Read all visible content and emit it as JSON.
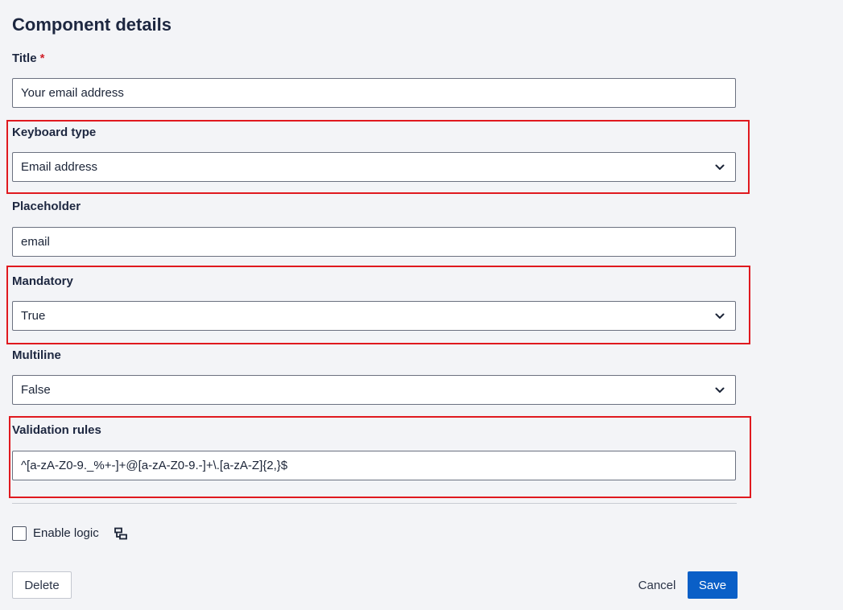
{
  "panel": {
    "title": "Component details"
  },
  "fields": {
    "title": {
      "label": "Title",
      "required_marker": "*",
      "value": "Your email address"
    },
    "keyboard_type": {
      "label": "Keyboard type",
      "value": "Email address"
    },
    "placeholder": {
      "label": "Placeholder",
      "value": "email"
    },
    "mandatory": {
      "label": "Mandatory",
      "value": "True"
    },
    "multiline": {
      "label": "Multiline",
      "value": "False"
    },
    "validation_rules": {
      "label": "Validation rules",
      "value": "^[a-zA-Z0-9._%+-]+@[a-zA-Z0-9.-]+\\.[a-zA-Z]{2,}$"
    }
  },
  "logic": {
    "label": "Enable logic",
    "checked": false,
    "icon": "logic-flow-icon"
  },
  "actions": {
    "delete_label": "Delete",
    "cancel_label": "Cancel",
    "save_label": "Save"
  },
  "colors": {
    "highlight": "#e0191f",
    "primary": "#0a5fc7",
    "required": "#d0202a",
    "background": "#f3f4f7"
  }
}
